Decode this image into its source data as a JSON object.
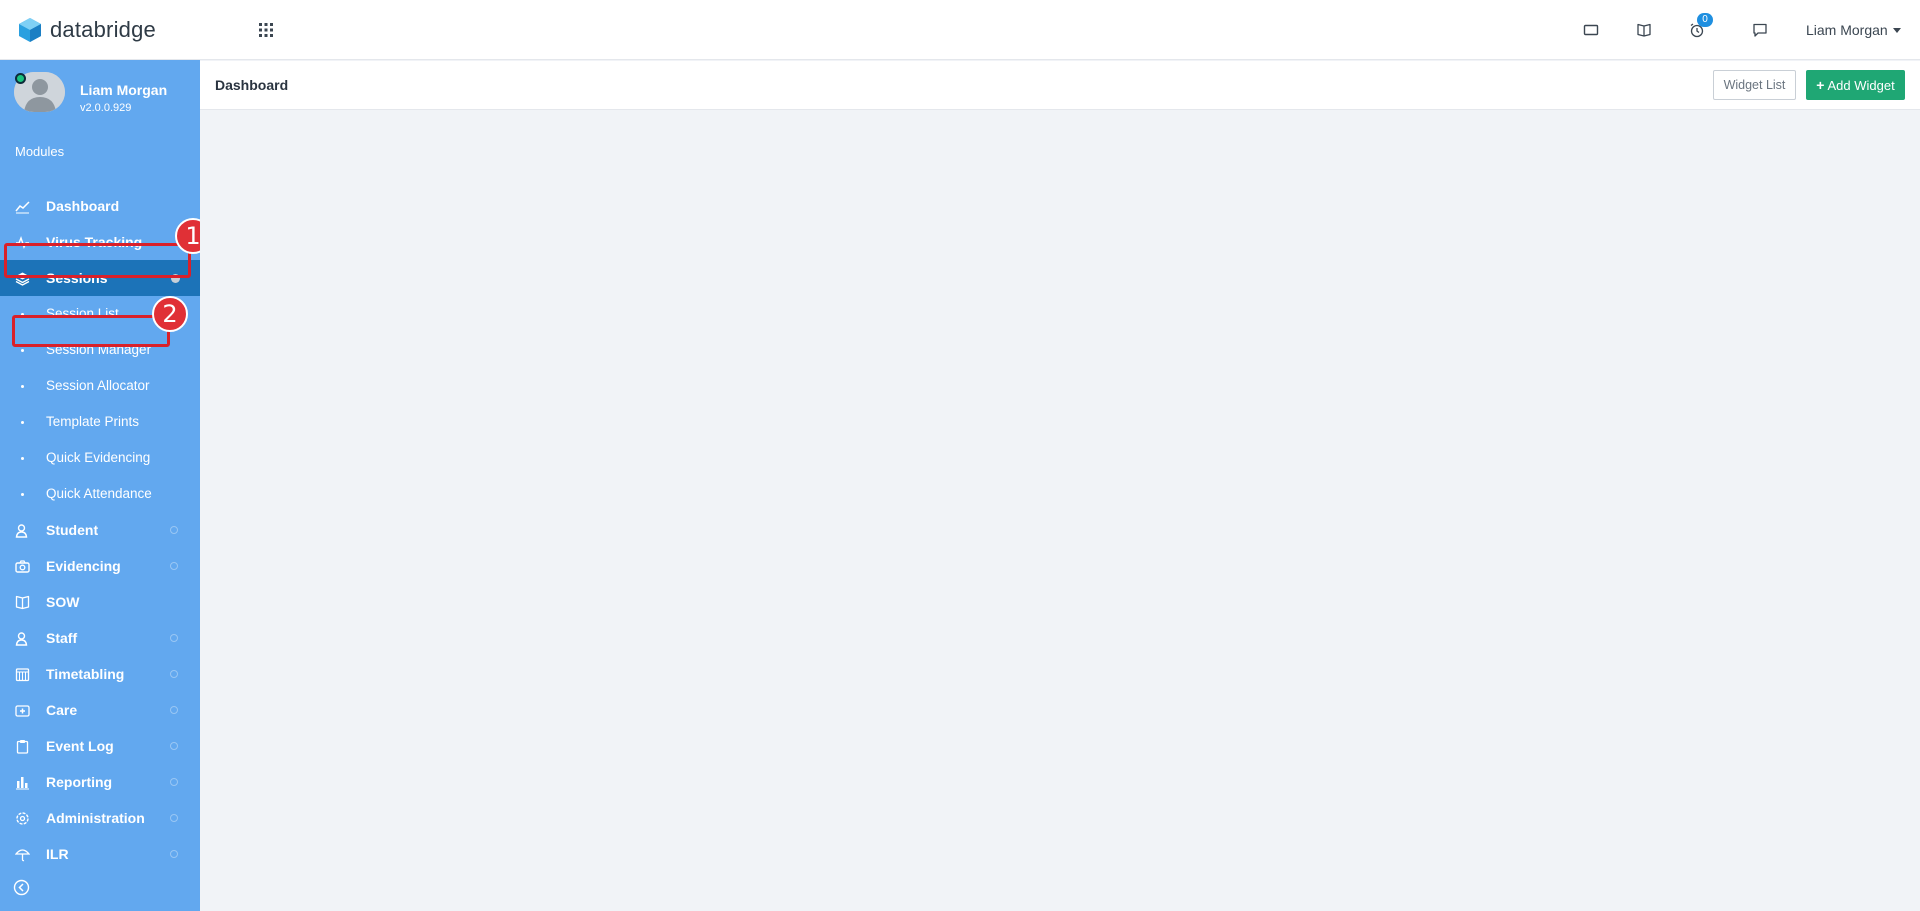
{
  "brand": {
    "name": "databridge"
  },
  "topbar": {
    "notification_count": "0",
    "user_name": "Liam Morgan"
  },
  "profile": {
    "name": "Liam Morgan",
    "version": "v2.0.0.929"
  },
  "sidebar": {
    "section_title": "Modules",
    "items": [
      {
        "label": "Dashboard",
        "icon": "chart-line-icon"
      },
      {
        "label": "Virus Tracking",
        "icon": "pulse-icon"
      },
      {
        "label": "Sessions",
        "icon": "layers-icon",
        "active": true
      },
      {
        "label": "Student",
        "icon": "user-icon"
      },
      {
        "label": "Evidencing",
        "icon": "camera-icon"
      },
      {
        "label": "SOW",
        "icon": "book-icon"
      },
      {
        "label": "Staff",
        "icon": "user-icon"
      },
      {
        "label": "Timetabling",
        "icon": "calendar-icon"
      },
      {
        "label": "Care",
        "icon": "first-aid-icon"
      },
      {
        "label": "Event Log",
        "icon": "clipboard-icon"
      },
      {
        "label": "Reporting",
        "icon": "bar-chart-icon"
      },
      {
        "label": "Administration",
        "icon": "gear-icon"
      },
      {
        "label": "ILR",
        "icon": "umbrella-icon"
      }
    ],
    "sessions_subitems": [
      "Session List",
      "Session Manager",
      "Session Allocator",
      "Template Prints",
      "Quick Evidencing",
      "Quick Attendance"
    ]
  },
  "annotations": {
    "marker_1": "1",
    "marker_2": "2"
  },
  "page": {
    "title": "Dashboard",
    "widget_list_label": "Widget List",
    "add_widget_label": "Add Widget"
  },
  "colors": {
    "sidebar_bg": "#62a8ef",
    "active_item_bg": "#1c73b8",
    "add_button": "#1fa774",
    "badge": "#1f8fe0",
    "highlight": "#d9202a"
  }
}
